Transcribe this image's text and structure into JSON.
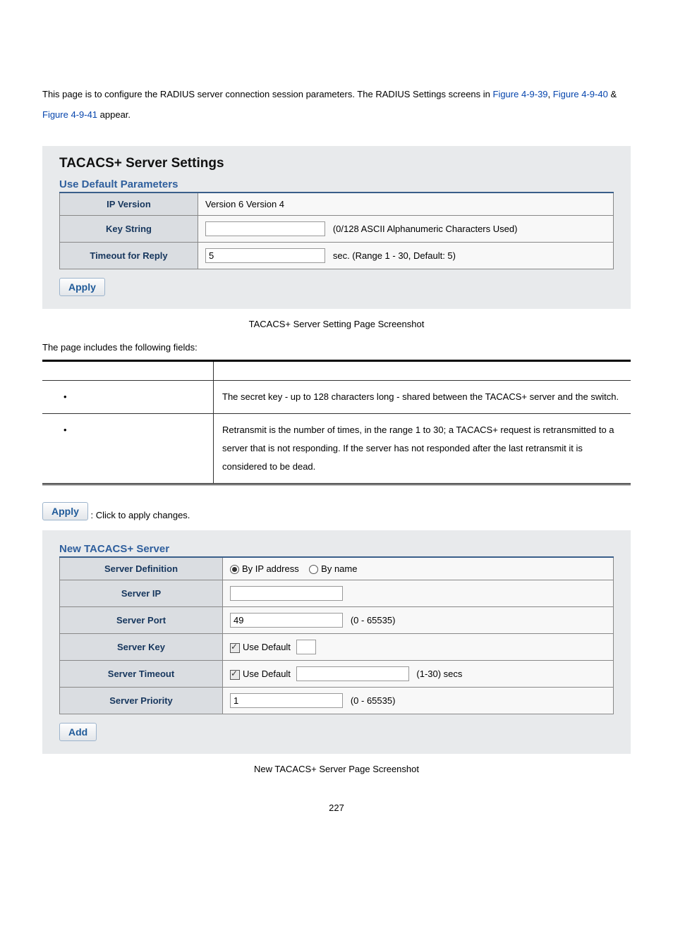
{
  "intro": {
    "t1": "This page is to configure the RADIUS server connection session parameters. The RADIUS Settings screens in ",
    "l1": "Figure 4-9-39",
    "t2": ", ",
    "l2": "Figure 4-9-40",
    "t3": " & ",
    "l3": "Figure 4-9-41",
    "t4": " appear."
  },
  "panel1": {
    "title": "TACACS+ Server Settings",
    "section": "Use Default Parameters",
    "rows": {
      "ipversion_label": "IP Version",
      "ipversion_value": "Version 6 Version 4",
      "keystring_label": "Key String",
      "keystring_hint": "(0/128 ASCII Alphanumeric Characters Used)",
      "timeout_label": "Timeout for Reply",
      "timeout_value": "5",
      "timeout_hint": "sec. (Range 1 - 30, Default: 5)"
    },
    "apply": "Apply"
  },
  "caption1": "TACACS+ Server Setting Page Screenshot",
  "fields_intro": "The page includes the following fields:",
  "desc": {
    "row1": "The secret key - up to 128 characters long - shared between the TACACS+ server and the switch.",
    "row2": "Retransmit is the number of times, in the range 1 to 30; a TACACS+ request is retransmitted to a server that is not responding. If the server has not responded after the last retransmit it is considered to be dead."
  },
  "apply_inline": {
    "btn": "Apply",
    "txt": ": Click to apply changes."
  },
  "panel2": {
    "section": "New TACACS+ Server",
    "rows": {
      "def_label": "Server Definition",
      "def_opt1": "By IP address",
      "def_opt2": "By name",
      "ip_label": "Server IP",
      "ip_value": "",
      "port_label": "Server Port",
      "port_value": "49",
      "port_hint": "(0 - 65535)",
      "key_label": "Server Key",
      "key_usedef": "Use Default",
      "key_value": "",
      "timeout_label": "Server Timeout",
      "timeout_usedef": "Use Default",
      "timeout_value": "",
      "timeout_hint": "(1-30) secs",
      "prio_label": "Server Priority",
      "prio_value": "1",
      "prio_hint": "(0 - 65535)"
    },
    "add": "Add"
  },
  "caption2": "New TACACS+ Server Page Screenshot",
  "pagenum": "227"
}
